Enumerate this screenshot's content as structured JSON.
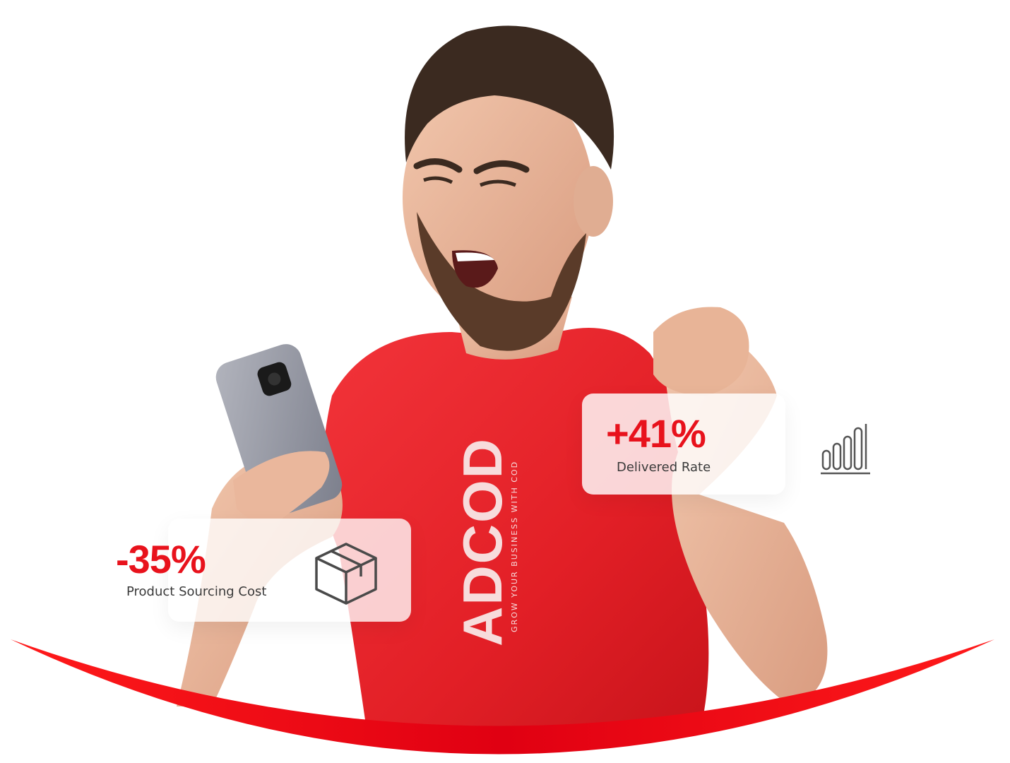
{
  "brand": {
    "accent": "#e8121c",
    "shirt_text": "ADCOD",
    "shirt_tagline": "GROW YOUR BUSINESS WITH COD"
  },
  "stats": {
    "delivered": {
      "value": "+41%",
      "label": "Delivered Rate",
      "icon": "bar-chart-icon"
    },
    "sourcing": {
      "value": "-35%",
      "label": "Product Sourcing Cost",
      "icon": "package-box-icon"
    }
  }
}
